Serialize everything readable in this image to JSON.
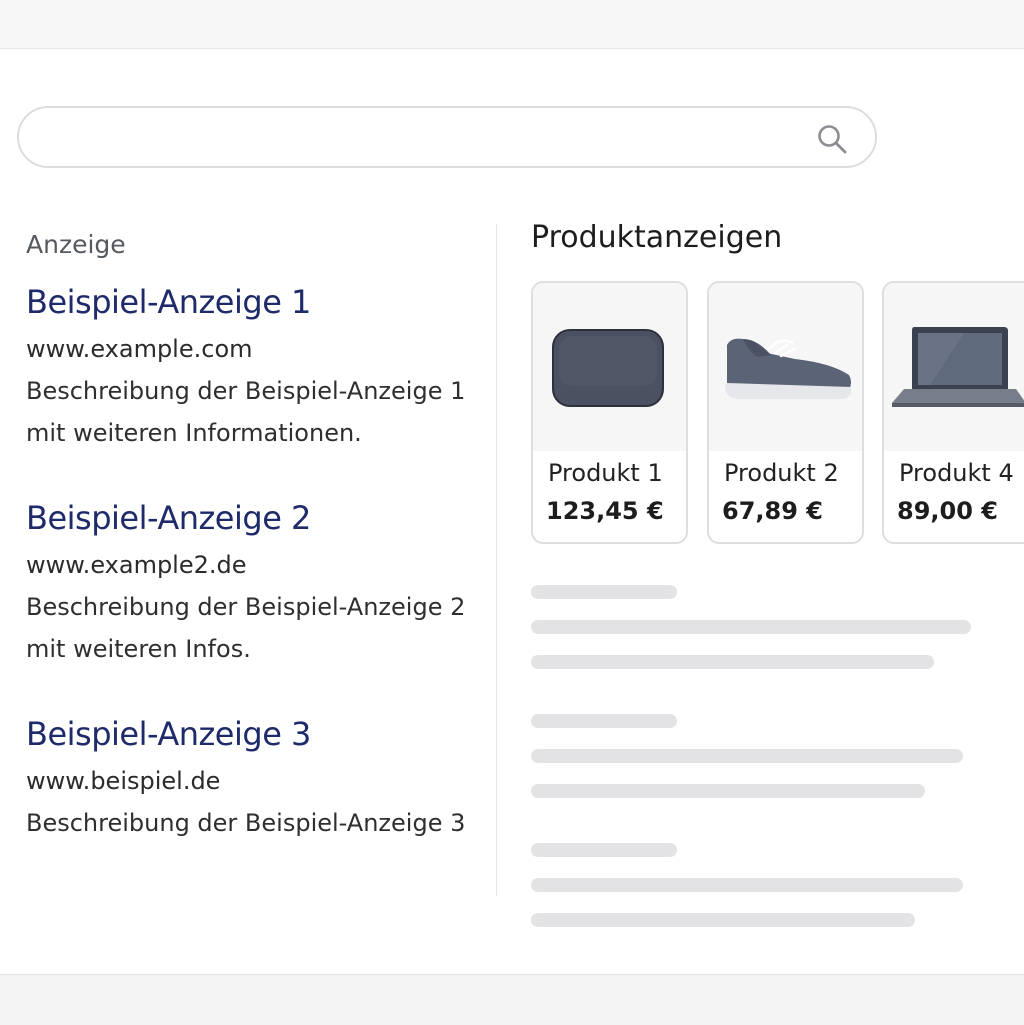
{
  "search": {
    "value": "",
    "placeholder": "",
    "icon": "search-icon"
  },
  "ads": {
    "label": "Anzeige",
    "items": [
      {
        "title": "Beispiel-Anzeige 1",
        "url": "www.example.com",
        "description": "Beschreibung der Beispiel-Anzeige 1 mit weiteren Informationen."
      },
      {
        "title": "Beispiel-Anzeige 2",
        "url": "www.example2.de",
        "description": "Beschreibung der Beispiel-Anzeige 2 mit weiteren Infos."
      },
      {
        "title": "Beispiel-Anzeige 3",
        "url": "www.beispiel.de",
        "description": "Beschreibung der Beispiel-Anzeige 3"
      }
    ]
  },
  "products": {
    "heading": "Produktanzeigen",
    "items": [
      {
        "name": "Produkt 1",
        "price": "123,45 €",
        "icon": "cushion-image"
      },
      {
        "name": "Produkt 2",
        "price": "67,89 €",
        "icon": "shoe-image"
      },
      {
        "name": "Produkt 4",
        "price": "89,00 €",
        "icon": "laptop-image"
      }
    ]
  },
  "colors": {
    "ad_title": "#1e2a6a",
    "placeholder_bar": "#e3e3e5",
    "border": "#dedee1"
  }
}
